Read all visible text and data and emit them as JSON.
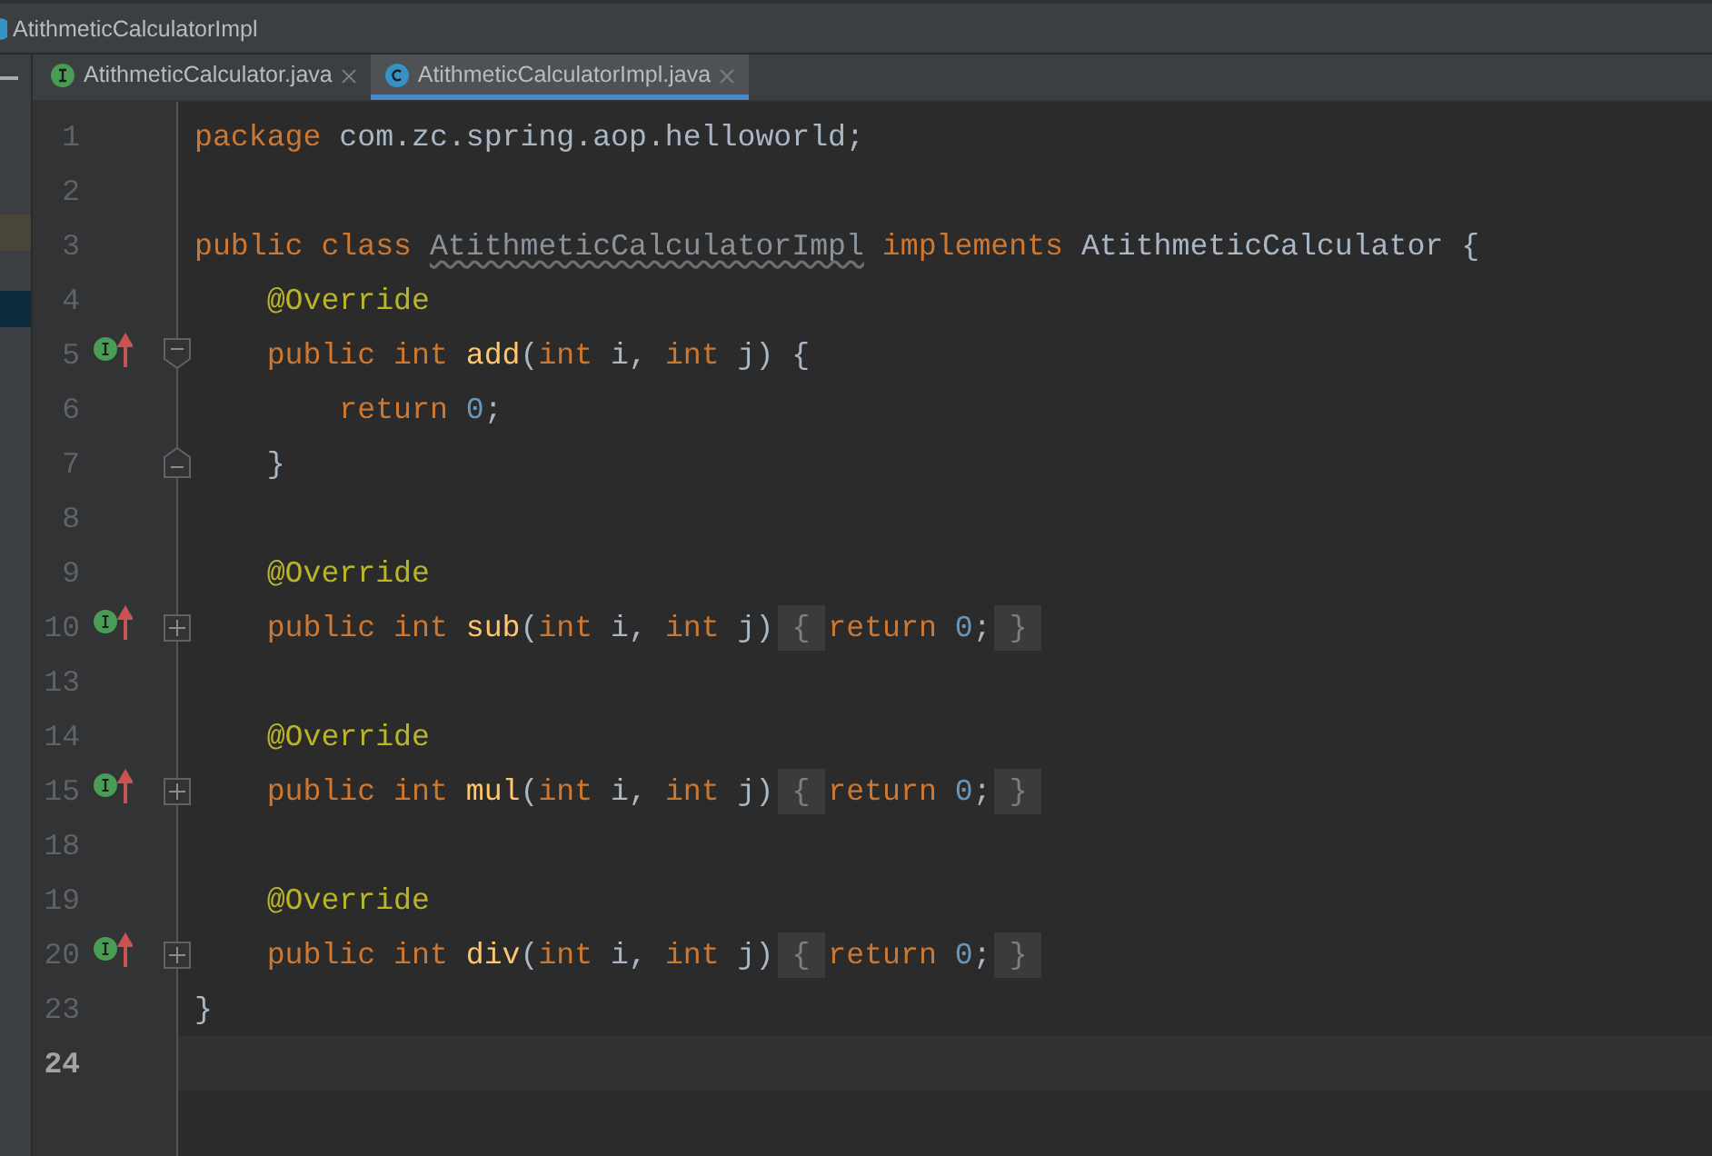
{
  "breadcrumb": {
    "label": "AtithmeticCalculatorImpl"
  },
  "tabs": [
    {
      "label": "AtithmeticCalculator.java",
      "kind": "interface",
      "selected": false
    },
    {
      "label": "AtithmeticCalculatorImpl.java",
      "kind": "class",
      "selected": true
    }
  ],
  "lines": [
    {
      "number": "1",
      "current": false,
      "implements_marker": false,
      "kind": "plain",
      "tokens": [
        {
          "kind": "keyword",
          "text": "package"
        },
        {
          "kind": "plain",
          "text": " com.zc.spring.aop.helloworld;"
        }
      ]
    },
    {
      "number": "2",
      "current": false,
      "implements_marker": false,
      "kind": "plain"
    },
    {
      "number": "3",
      "current": false,
      "implements_marker": false,
      "kind": "plain",
      "tokens": [
        {
          "kind": "keyword",
          "text": "public class "
        },
        {
          "kind": "warned",
          "text": "AtithmeticCalculatorImpl"
        },
        {
          "kind": "keyword",
          "text": " implements"
        },
        {
          "kind": "plain",
          "text": " AtithmeticCalculator {"
        }
      ]
    },
    {
      "number": "4",
      "current": false,
      "implements_marker": false,
      "kind": "plain",
      "tokens": [
        {
          "kind": "annotation",
          "text": "    @Override"
        }
      ]
    },
    {
      "number": "5",
      "current": false,
      "implements_marker": true,
      "kind": "foldstart",
      "tokens": [
        {
          "kind": "keyword",
          "text": "    public int "
        },
        {
          "kind": "method",
          "text": "add"
        },
        {
          "kind": "plain",
          "text": "("
        },
        {
          "kind": "keyword",
          "text": "int"
        },
        {
          "kind": "plain",
          "text": " i, "
        },
        {
          "kind": "keyword",
          "text": "int"
        },
        {
          "kind": "plain",
          "text": " j) {"
        }
      ]
    },
    {
      "number": "6",
      "current": false,
      "implements_marker": false,
      "kind": "plain",
      "tokens": [
        {
          "kind": "keyword",
          "text": "        return "
        },
        {
          "kind": "number",
          "text": "0"
        },
        {
          "kind": "plain",
          "text": ";"
        }
      ]
    },
    {
      "number": "7",
      "current": false,
      "implements_marker": false,
      "kind": "foldend",
      "tokens": [
        {
          "kind": "plain",
          "text": "    }"
        }
      ]
    },
    {
      "number": "8",
      "current": false,
      "implements_marker": false,
      "kind": "plain"
    },
    {
      "number": "9",
      "current": false,
      "implements_marker": false,
      "kind": "plain",
      "tokens": [
        {
          "kind": "annotation",
          "text": "    @Override"
        }
      ]
    },
    {
      "number": "10",
      "current": false,
      "implements_marker": true,
      "kind": "collapsed",
      "tokens": [
        {
          "kind": "keyword",
          "text": "    public int "
        },
        {
          "kind": "method",
          "text": "sub"
        },
        {
          "kind": "plain",
          "text": "("
        },
        {
          "kind": "keyword",
          "text": "int"
        },
        {
          "kind": "plain",
          "text": " i, "
        },
        {
          "kind": "keyword",
          "text": "int"
        },
        {
          "kind": "plain",
          "text": " j)"
        },
        {
          "kind": "folded",
          "text": "{"
        },
        {
          "kind": "keyword",
          "text": "return "
        },
        {
          "kind": "number",
          "text": "0"
        },
        {
          "kind": "plain",
          "text": ";"
        },
        {
          "kind": "folded",
          "text": "}"
        }
      ]
    },
    {
      "number": "13",
      "current": false,
      "implements_marker": false,
      "kind": "plain"
    },
    {
      "number": "14",
      "current": false,
      "implements_marker": false,
      "kind": "plain",
      "tokens": [
        {
          "kind": "annotation",
          "text": "    @Override"
        }
      ]
    },
    {
      "number": "15",
      "current": false,
      "implements_marker": true,
      "kind": "collapsed",
      "tokens": [
        {
          "kind": "keyword",
          "text": "    public int "
        },
        {
          "kind": "method",
          "text": "mul"
        },
        {
          "kind": "plain",
          "text": "("
        },
        {
          "kind": "keyword",
          "text": "int"
        },
        {
          "kind": "plain",
          "text": " i, "
        },
        {
          "kind": "keyword",
          "text": "int"
        },
        {
          "kind": "plain",
          "text": " j)"
        },
        {
          "kind": "folded",
          "text": "{"
        },
        {
          "kind": "keyword",
          "text": "return "
        },
        {
          "kind": "number",
          "text": "0"
        },
        {
          "kind": "plain",
          "text": ";"
        },
        {
          "kind": "folded",
          "text": "}"
        }
      ]
    },
    {
      "number": "18",
      "current": false,
      "implements_marker": false,
      "kind": "plain"
    },
    {
      "number": "19",
      "current": false,
      "implements_marker": false,
      "kind": "plain",
      "tokens": [
        {
          "kind": "annotation",
          "text": "    @Override"
        }
      ]
    },
    {
      "number": "20",
      "current": false,
      "implements_marker": true,
      "kind": "collapsed",
      "tokens": [
        {
          "kind": "keyword",
          "text": "    public int "
        },
        {
          "kind": "method",
          "text": "div"
        },
        {
          "kind": "plain",
          "text": "("
        },
        {
          "kind": "keyword",
          "text": "int"
        },
        {
          "kind": "plain",
          "text": " i, "
        },
        {
          "kind": "keyword",
          "text": "int"
        },
        {
          "kind": "plain",
          "text": " j)"
        },
        {
          "kind": "folded",
          "text": "{"
        },
        {
          "kind": "keyword",
          "text": "return "
        },
        {
          "kind": "number",
          "text": "0"
        },
        {
          "kind": "plain",
          "text": ";"
        },
        {
          "kind": "folded",
          "text": "}"
        }
      ]
    },
    {
      "number": "23",
      "current": false,
      "implements_marker": false,
      "kind": "plain",
      "tokens": [
        {
          "kind": "plain",
          "text": "}"
        }
      ]
    },
    {
      "number": "24",
      "current": true,
      "implements_marker": false,
      "kind": "plain"
    }
  ]
}
